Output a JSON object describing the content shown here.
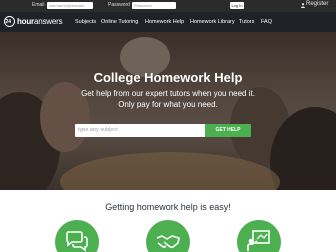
{
  "topbar": {
    "email_label": "Email",
    "email_placeholder": "username@domain",
    "password_label": "Password",
    "password_placeholder": "Password",
    "login_label": "Log In",
    "register_label": "Register"
  },
  "nav": {
    "logo_bold": "24",
    "logo_hour": "hour",
    "logo_answers": "answers",
    "items": [
      "Subjects",
      "Online Tutoring",
      "Homework Help",
      "Homework Library",
      "Tutors",
      "FAQ"
    ]
  },
  "hero": {
    "title": "College Homework Help",
    "subtitle_line1": "Get help from our expert tutors when you need it.",
    "subtitle_line2": "Only pay for what you need.",
    "search_placeholder": "type any subject",
    "button_label": "GET HELP"
  },
  "features": {
    "title": "Getting homework help is easy!",
    "icons": [
      "chat-bubbles-icon",
      "handshake-icon",
      "whiteboard-icon"
    ],
    "accent": "#4caf50"
  }
}
